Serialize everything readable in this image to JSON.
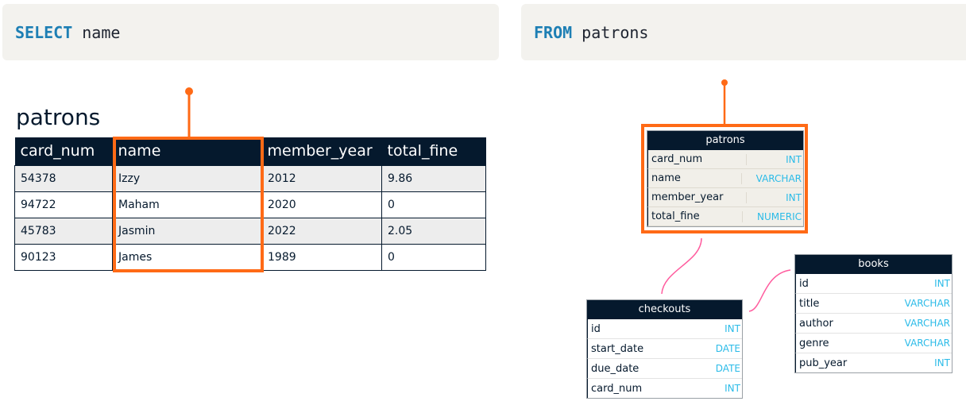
{
  "select_clause": {
    "keyword": "SELECT",
    "text": "name"
  },
  "from_clause": {
    "keyword": "FROM",
    "text": "patrons"
  },
  "table_title": "patrons",
  "table": {
    "headers": [
      "card_num",
      "name",
      "member_year",
      "total_fine"
    ],
    "rows": [
      [
        "54378",
        "Izzy",
        "2012",
        "9.86"
      ],
      [
        "94722",
        "Maham",
        "2020",
        "0"
      ],
      [
        "45783",
        "Jasmin",
        "2022",
        "2.05"
      ],
      [
        "90123",
        "James",
        "1989",
        "0"
      ]
    ]
  },
  "schema": {
    "patrons": {
      "title": "patrons",
      "fields": [
        {
          "name": "card_num",
          "type": "INT"
        },
        {
          "name": "name",
          "type": "VARCHAR"
        },
        {
          "name": "member_year",
          "type": "INT"
        },
        {
          "name": "total_fine",
          "type": "NUMERIC"
        }
      ]
    },
    "checkouts": {
      "title": "checkouts",
      "fields": [
        {
          "name": "id",
          "type": "INT"
        },
        {
          "name": "start_date",
          "type": "DATE"
        },
        {
          "name": "due_date",
          "type": "DATE"
        },
        {
          "name": "card_num",
          "type": "INT"
        }
      ]
    },
    "books": {
      "title": "books",
      "fields": [
        {
          "name": "id",
          "type": "INT"
        },
        {
          "name": "title",
          "type": "VARCHAR"
        },
        {
          "name": "author",
          "type": "VARCHAR"
        },
        {
          "name": "genre",
          "type": "VARCHAR"
        },
        {
          "name": "pub_year",
          "type": "INT"
        }
      ]
    }
  },
  "colors": {
    "highlight": "#ff6a16",
    "keyword": "#1d7fb4",
    "header_bg": "#05192d",
    "type_text": "#2bbbe8",
    "relation_line": "#ff5c9e"
  }
}
